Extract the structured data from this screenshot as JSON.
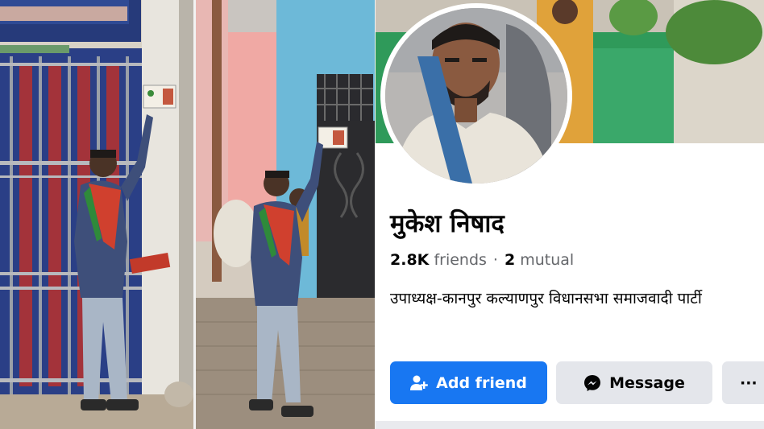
{
  "profile": {
    "name": "मुकेश निषाद",
    "friends_count": "2.8K",
    "friends_label": "friends",
    "separator": "·",
    "mutual_count": "2",
    "mutual_label": "mutual",
    "bio": "उपाध्यक्ष-कानपुर कल्याणपुर विधानसभा समाजवादी पार्टी"
  },
  "actions": {
    "add_friend_label": "Add friend",
    "message_label": "Message",
    "more_label": "···"
  },
  "colors": {
    "primary_button": "#1877f2",
    "secondary_button": "#e4e6eb",
    "text": "#050505",
    "muted_text": "#65676b"
  },
  "icons": {
    "add_friend": "add-person-icon",
    "message": "messenger-icon",
    "more": "more-dots-icon"
  }
}
